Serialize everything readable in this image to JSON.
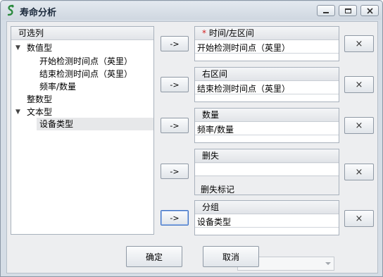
{
  "window": {
    "title": "寿命分析",
    "minimize_icon": "minimize-icon",
    "maximize_icon": "maximize-icon",
    "close_icon": "close-icon",
    "app_icon": "life-analysis-app-icon"
  },
  "variables": {
    "header": "可选列",
    "groups": [
      {
        "label": "数值型",
        "expanded": true,
        "children": [
          "开始检测时间点（英里）",
          "结束检测时间点（英里）",
          "频率/数量"
        ]
      },
      {
        "label": "整数型",
        "expanded": false,
        "children": []
      },
      {
        "label": "文本型",
        "expanded": true,
        "children": [
          "设备类型"
        ]
      }
    ],
    "selected_item": "设备类型"
  },
  "fields": {
    "time_left": {
      "required_mark": "*",
      "label": "时间/左区间",
      "value": "开始检测时间点（英里）"
    },
    "right_interval": {
      "label": "右区间",
      "value": "结束检测时间点（英里）"
    },
    "count": {
      "label": "数量",
      "value": "频率/数量"
    },
    "censor": {
      "label": "删失",
      "value": "",
      "mark_label": "删失标记",
      "mark_value": ""
    },
    "group": {
      "label": "分组",
      "value": "设备类型"
    }
  },
  "buttons": {
    "add_label": "->",
    "remove_label": "×",
    "ok_label": "确定",
    "cancel_label": "取消"
  },
  "colors": {
    "required": "#d21f1f",
    "focus_border": "#3a6fc4"
  }
}
